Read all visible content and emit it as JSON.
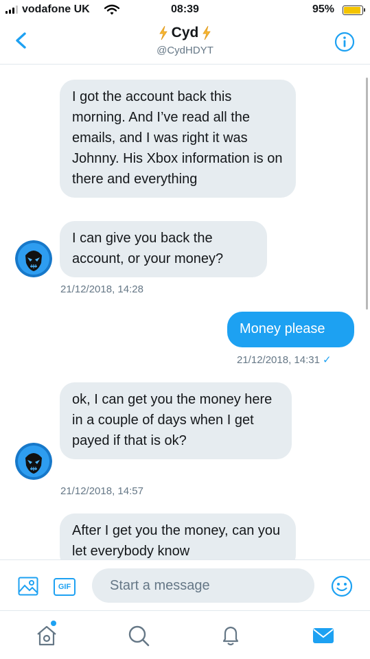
{
  "status_bar": {
    "carrier": "vodafone UK",
    "time": "08:39",
    "battery": "95%",
    "battery_level": 0.95,
    "signal_bars": 3
  },
  "header": {
    "name": "Cyd",
    "handle": "@CydHDYT",
    "back_icon": "chevron-left-icon",
    "info_icon": "info-icon"
  },
  "messages": [
    {
      "side": "left",
      "text": "I got the account back this morning. And I’ve read all the emails, and I was right it was Johnny. His Xbox information is on there and everything"
    },
    {
      "side": "left",
      "text": "I can give you back the account, or your money?",
      "timestamp": "21/12/2018, 14:28"
    },
    {
      "side": "right",
      "text": "Money please",
      "timestamp": "21/12/2018, 14:31",
      "read_check": "✓"
    },
    {
      "side": "left",
      "text": "ok, I can get you the money here in a couple of days when I get payed if that is ok?",
      "timestamp": "21/12/2018, 14:57"
    },
    {
      "side": "left",
      "text": "After I get you the money, can you let everybody know"
    }
  ],
  "composer": {
    "placeholder": "Start a message",
    "gif_label": "GIF"
  },
  "tabbar": {
    "items": [
      "home-icon",
      "search-icon",
      "notifications-icon",
      "messages-icon"
    ],
    "active": "messages-icon"
  },
  "colors": {
    "accent": "#1da1f2",
    "bubble_received": "#e6ecf0",
    "text_secondary": "#657786",
    "battery": "#f4c400"
  }
}
